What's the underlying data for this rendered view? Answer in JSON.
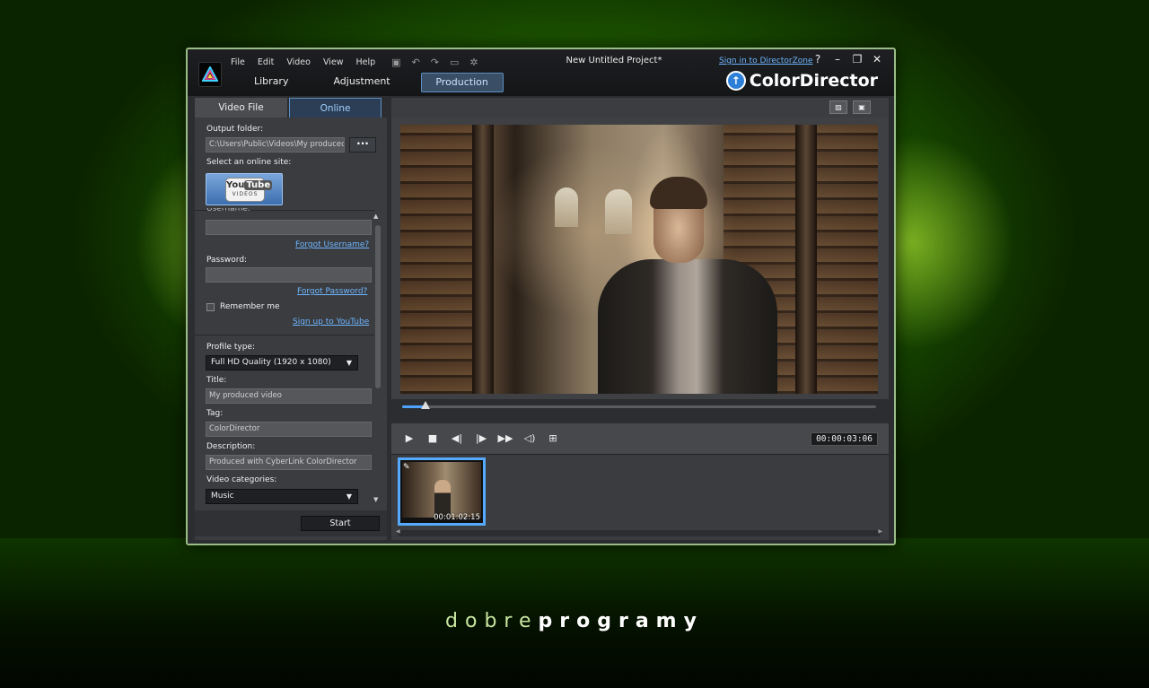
{
  "brand": {
    "part1": "dobre",
    "part2": "programy"
  },
  "window": {
    "menu": [
      "File",
      "Edit",
      "Video",
      "View",
      "Help"
    ],
    "project_title": "New Untitled Project*",
    "signin_link": "Sign in to DirectorZone",
    "help": "?",
    "minimize": "–",
    "maximize": "❐",
    "close": "✕",
    "tabs": {
      "library": "Library",
      "adjustment": "Adjustment",
      "production": "Production"
    },
    "app_name": "ColorDirector"
  },
  "left_panel": {
    "tab_video_file": "Video File",
    "tab_online": "Online",
    "output_folder_label": "Output folder:",
    "output_folder_value": "C:\\Users\\Public\\Videos\\My produced",
    "browse_label": "···",
    "online_site_label": "Select an online site:",
    "youtube": {
      "you": "You",
      "tube": "Tube",
      "videos": "VIDEOS"
    },
    "username_label": "Username:",
    "forgot_username": "Forgot Username?",
    "password_label": "Password:",
    "forgot_password": "Forgot Password?",
    "remember_me": "Remember me",
    "sign_up": "Sign up to YouTube",
    "profile_type_label": "Profile type:",
    "profile_type_value": "Full HD Quality (1920 x 1080)",
    "title_label": "Title:",
    "title_value": "My produced video",
    "tag_label": "Tag:",
    "tag_value": "ColorDirector",
    "description_label": "Description:",
    "description_value": "Produced with CyberLink ColorDirector",
    "video_categories_label": "Video categories:",
    "video_categories_value": "Music",
    "start_label": "Start"
  },
  "player": {
    "seek_progress": 0.05,
    "timecode": "00:00:03:06"
  },
  "filmstrip": {
    "clip_duration": "00:01:02:15"
  },
  "colors": {
    "accent_blue": "#55aaff",
    "link_blue": "#6fb6ff",
    "window_border": "#9bbd86"
  }
}
